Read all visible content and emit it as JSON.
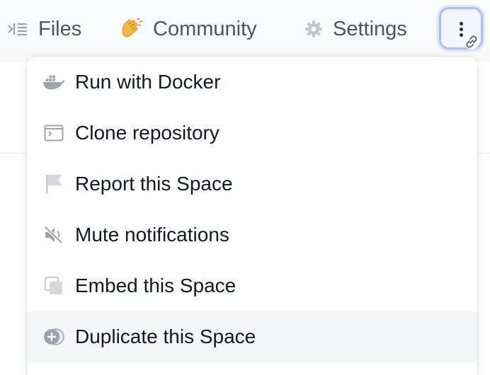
{
  "tabs": {
    "files": {
      "label": "Files",
      "icon": "files-icon"
    },
    "community": {
      "label": "Community",
      "icon": "clapping-hands-icon"
    },
    "settings": {
      "label": "Settings",
      "icon": "gear-icon"
    }
  },
  "more_button": {
    "icon": "vertical-dots-icon",
    "badge_icon": "link-icon"
  },
  "menu": {
    "items": [
      {
        "label": "Run with Docker",
        "icon": "docker-icon"
      },
      {
        "label": "Clone repository",
        "icon": "terminal-icon"
      },
      {
        "label": "Report this Space",
        "icon": "flag-icon"
      },
      {
        "label": "Mute notifications",
        "icon": "mute-icon"
      },
      {
        "label": "Embed this Space",
        "icon": "embed-icon"
      },
      {
        "label": "Duplicate this Space",
        "icon": "duplicate-icon",
        "highlighted": true
      }
    ]
  },
  "colors": {
    "accent": "#a9bdf7",
    "icon": "#9ca3af",
    "text": "#111827",
    "tab_text": "#4b5563"
  }
}
